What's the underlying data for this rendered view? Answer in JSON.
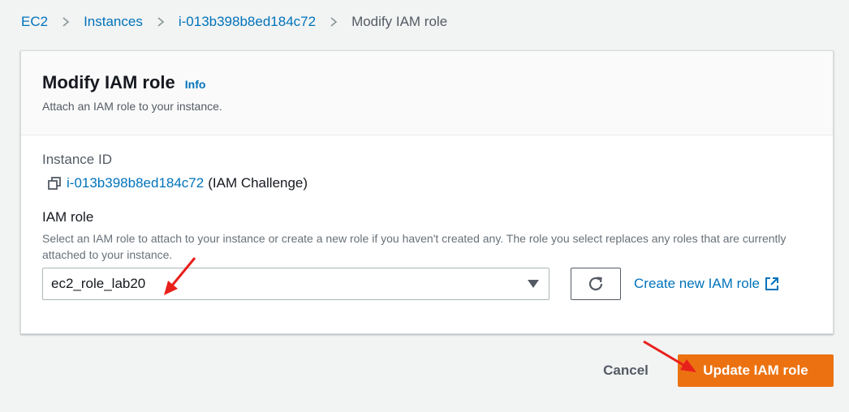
{
  "breadcrumb": {
    "items": [
      "EC2",
      "Instances",
      "i-013b398b8ed184c72"
    ],
    "current": "Modify IAM role"
  },
  "panel": {
    "title": "Modify IAM role",
    "info_label": "Info",
    "description": "Attach an IAM role to your instance."
  },
  "instance": {
    "label": "Instance ID",
    "id": "i-013b398b8ed184c72",
    "name": "(IAM Challenge)"
  },
  "iam_role": {
    "label": "IAM role",
    "description": "Select an IAM role to attach to your instance or create a new role if you haven't created any. The role you select replaces any roles that are currently attached to your instance.",
    "selected": "ec2_role_lab20",
    "create_link": "Create new IAM role"
  },
  "actions": {
    "cancel_label": "Cancel",
    "update_label": "Update IAM role"
  },
  "colors": {
    "link": "#0073bb",
    "primary": "#ec7211",
    "annotation_arrow": "#e8201c"
  },
  "icons": [
    "chevron-right-icon",
    "copy-icon",
    "caret-down-icon",
    "refresh-icon",
    "external-link-icon"
  ]
}
